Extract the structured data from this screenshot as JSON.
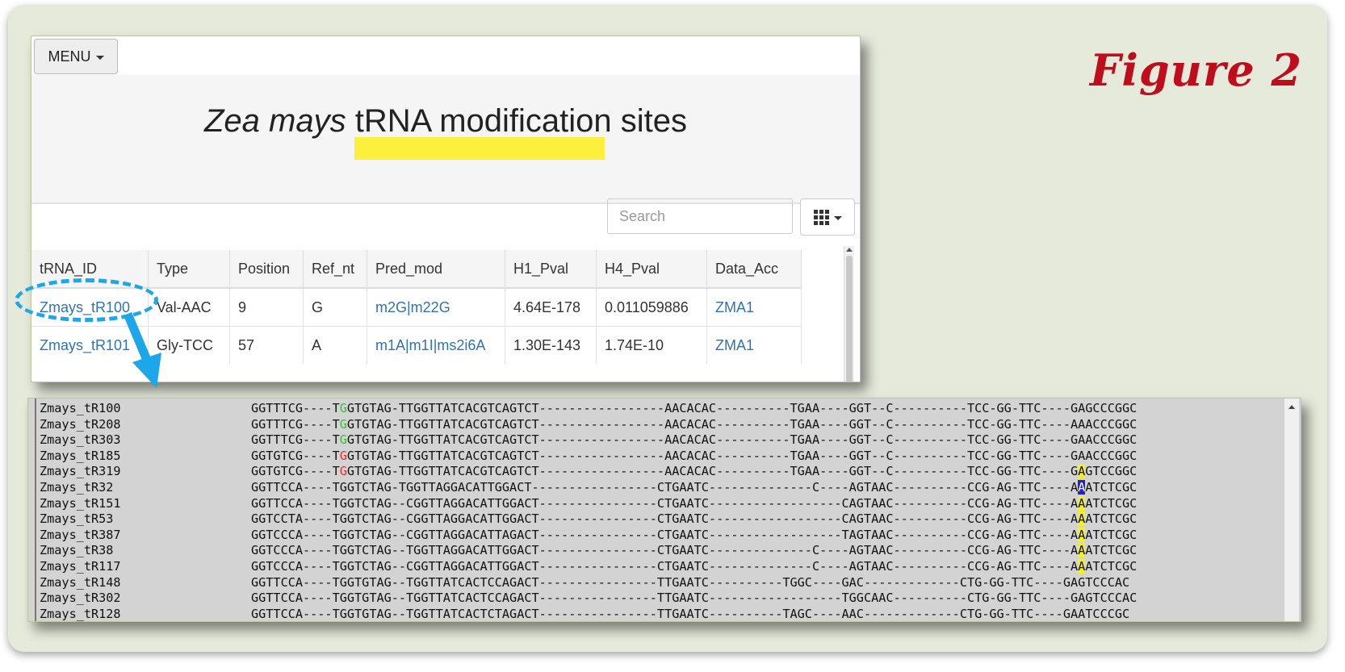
{
  "figure_label": "Figure 2",
  "web": {
    "menu_label": "MENU",
    "title_italic": "Zea mays",
    "title_rest": "tRNA modification sites",
    "search_placeholder": "Search",
    "columns_icon": "grid-icon",
    "table": {
      "headers": [
        "tRNA_ID",
        "Type",
        "Position",
        "Ref_nt",
        "Pred_mod",
        "H1_Pval",
        "H4_Pval",
        "Data_Acc"
      ],
      "rows": [
        {
          "trna_id": "Zmays_tR100",
          "type": "Val-AAC",
          "position": "9",
          "ref_nt": "G",
          "pred_mod": "m2G|m22G",
          "h1": "4.64E-178",
          "h4": "0.011059886",
          "acc": "ZMA1"
        },
        {
          "trna_id": "Zmays_tR101",
          "type": "Gly-TCC",
          "position": "57",
          "ref_nt": "A",
          "pred_mod": "m1A|m1I|ms2i6A",
          "h1": "1.30E-143",
          "h4": "1.74E-10",
          "acc": "ZMA1"
        }
      ]
    }
  },
  "alignment": {
    "rows": [
      {
        "id": "Zmays_tR100",
        "a": "GGTTTCG----T",
        "mark": "G",
        "b": "GTGTAG-TTGGTTATCACGTCAGTCT-----------------AACACAC----------TGAA----GGT--C----------TCC-GG-TTC----GA",
        "c": "G",
        "d": "CCCGGC"
      },
      {
        "id": "Zmays_tR208",
        "a": "GGTTTCG----T",
        "mark": "G",
        "b": "GTGTAG-TTGGTTATCACGTCAGTCT-----------------AACACAC----------TGAA----GGT--C----------TCC-GG-TTC----AA",
        "c": "A",
        "d": "CCCGGC"
      },
      {
        "id": "Zmays_tR303",
        "a": "GGTTTCG----T",
        "mark": "G",
        "b": "GTGTAG-TTGGTTATCACGTCAGTCT-----------------AACACAC----------TGAA----GGT--C----------TCC-GG-TTC----GA",
        "c": "A",
        "d": "CCCGGC"
      },
      {
        "id": "Zmays_tR185",
        "a": "GGTGTCG----T",
        "mark": "G",
        "b": "GTGTAG-TTGGTTATCACGTCAGTCT-----------------AACACAC----------TGAA----GGT--C----------TCC-GG-TTC----GA",
        "c": "A",
        "d": "CCCGGC"
      },
      {
        "id": "Zmays_tR319",
        "a": "GGTGTCG----T",
        "mark": "G",
        "b": "GTGTAG-TTGGTTATCACGTCAGTCT-----------------AACACAC----------TGAA----GGT--C----------TCC-GG-TTC----G",
        "c": "A",
        "d": "GTCCGGC"
      },
      {
        "id": "Zmays_tR32",
        "a": "GGTTCCA----T",
        "mark": "G",
        "b": "GTCTAG-TGGTTAGGACATTGGACT-----------------CTGAATC--------------C----AGTAAC----------CCG-AG-TTC----A",
        "c": "A",
        "d": "ATCTCGC"
      },
      {
        "id": "Zmays_tR151",
        "a": "GGTTCCA----T",
        "mark": "G",
        "b": "GTCTAG--CGGTTAGGACATTGGACT----------------CTGAATC------------------CAGTAAC----------CCG-AG-TTC----A",
        "c": "A",
        "d": "ATCTCGC"
      },
      {
        "id": "Zmays_tR53",
        "a": "GGTCCTA----T",
        "mark": "G",
        "b": "GTCTAG--CGGTTAGGACATTGGACT----------------CTGAATC------------------CAGTAAC----------CCG-AG-TTC----A",
        "c": "A",
        "d": "ATCTCGC"
      },
      {
        "id": "Zmays_tR387",
        "a": "GGTCCCA----T",
        "mark": "G",
        "b": "GTCTAG--CGGTTAGGACATTAGACT----------------CTGAATC------------------TAGTAAC----------CCG-AG-TTC----A",
        "c": "A",
        "d": "ATCTCGC"
      },
      {
        "id": "Zmays_tR38",
        "a": "GGTCCCA----T",
        "mark": "G",
        "b": "GTCTAG--TGGTTAGGACATTGGACT----------------CTGAATC--------------C----AGTAAC----------CCG-AG-TTC----A",
        "c": "A",
        "d": "ATCTCGC"
      },
      {
        "id": "Zmays_tR117",
        "a": "GGTCCCA----T",
        "mark": "G",
        "b": "GTCTAG--CGGTTAGGACATTGGACT----------------CTGAATC--------------C----AGTAAC----------CCG-AG-TTC----A",
        "c": "A",
        "d": "ATCTCGC"
      },
      {
        "id": "Zmays_tR148",
        "a": "GGTTCCA----T",
        "mark": "G",
        "b": "GTGTAG--TGGTTATCACTCCAGACT----------------TTGAATC----------TGGC----GAC-------------CTG-GG-TTC----GA",
        "c": "G",
        "d": "TCCCAC"
      },
      {
        "id": "Zmays_tR302",
        "a": "GGTTCCA----T",
        "mark": "G",
        "b": "GTGTAG--TGGTTATCACTCCAGACT----------------TTGAATC------------------TGGCAAC----------CTG-GG-TTC----GA",
        "c": "G",
        "d": "TCCCAC"
      },
      {
        "id": "Zmays_tR128",
        "a": "GGTTCCA----T",
        "mark": "G",
        "b": "GTGTAG--TGGTTATCACTCTAGACT----------------TTGAATC----------TAGC----AAC-------------CTG-GG-TTC----GA",
        "c": "A",
        "d": "TCCCGC"
      }
    ]
  },
  "colors": {
    "link": "#2f73b5",
    "figure_label": "#c00d1b",
    "callout": "#1ba7ea",
    "highlight": "#fcf03c",
    "selection": "#2222d0"
  }
}
